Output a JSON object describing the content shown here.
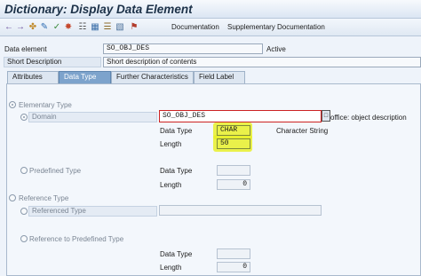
{
  "window": {
    "title": "Dictionary: Display Data Element"
  },
  "toolbar": {
    "documentation_label": "Documentation",
    "supplementary_label": "Supplementary Documentation"
  },
  "header": {
    "data_element_label": "Data element",
    "data_element_value": "SO_OBJ_DES",
    "status": "Active",
    "short_desc_label": "Short Description",
    "short_desc_value": "Short description of contents"
  },
  "tabs": [
    {
      "label": "Attributes"
    },
    {
      "label": "Data Type",
      "active": true
    },
    {
      "label": "Further Characteristics"
    },
    {
      "label": "Field Label"
    }
  ],
  "panel": {
    "elementary_type_label": "Elementary Type",
    "domain_label": "Domain",
    "domain_value": "SO_OBJ_DES",
    "domain_desc": "office: object description",
    "domain_data_type_label": "Data Type",
    "domain_data_type_value": "CHAR",
    "domain_data_type_text": "Character String",
    "domain_length_label": "Length",
    "domain_length_value": "50",
    "predefined_type_label": "Predefined Type",
    "predef_data_type_label": "Data Type",
    "predef_length_label": "Length",
    "predef_length_value": "0",
    "reference_type_label": "Reference Type",
    "referenced_type_label": "Referenced Type",
    "ref_predefined_label": "Reference to Predefined Type",
    "refpre_data_type_label": "Data Type",
    "refpre_length_label": "Length",
    "refpre_length_value": "0"
  },
  "colors": {
    "active_tab": "#7da3cc",
    "highlight": "#e8f02a",
    "error_border": "#cc2222"
  }
}
